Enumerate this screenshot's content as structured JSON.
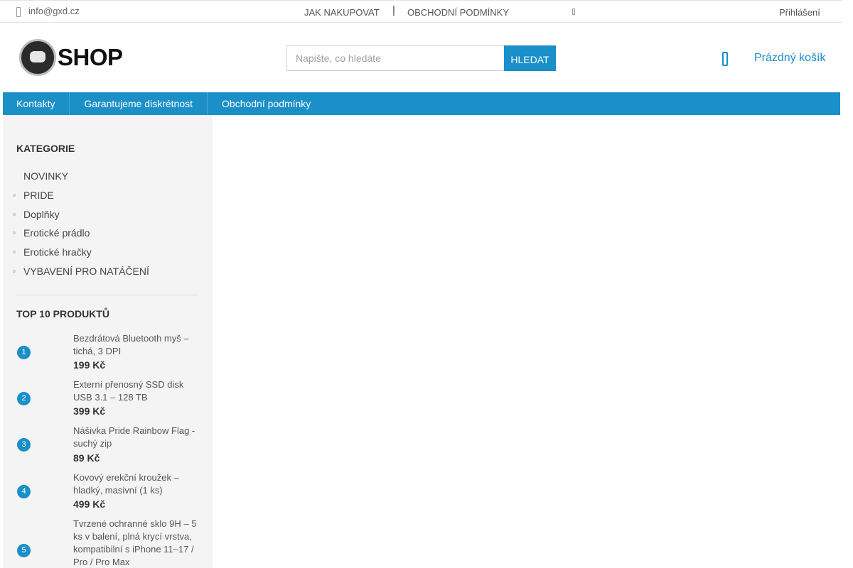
{
  "topbar": {
    "email": "info@gxd.cz",
    "links": [
      "JAK NAKUPOVAT",
      "OBCHODNÍ PODMÍNKY"
    ],
    "separator": "|",
    "login": "Přihlášení"
  },
  "header": {
    "logo_text": "SHOP",
    "search_placeholder": "Napište, co hledáte",
    "search_button": "HLEDAT",
    "cart_label": "Prázdný košík"
  },
  "nav": {
    "items": [
      "Kontakty",
      "Garantujeme diskrétnost",
      "Obchodní podmínky"
    ]
  },
  "sidebar": {
    "categories_title": "KATEGORIE",
    "categories": [
      "NOVINKY",
      "PRIDE",
      "Doplňky",
      "Erotické prádlo",
      "Erotické hračky",
      "VYBAVENÍ PRO NATÁČENÍ"
    ],
    "top_title": "TOP 10 PRODUKTŮ",
    "products": [
      {
        "rank": "1",
        "name": "Bezdrátová Bluetooth myš – tichá, 3 DPI",
        "price": "199 Kč"
      },
      {
        "rank": "2",
        "name": "Externí přenosný SSD disk USB 3.1 – 128 TB",
        "price": "399 Kč"
      },
      {
        "rank": "3",
        "name": "Nášivka Pride Rainbow Flag - suchý zip",
        "price": "89 Kč"
      },
      {
        "rank": "4",
        "name": "Kovový erekční kroužek – hladký, masivní (1 ks)",
        "price": "499 Kč"
      },
      {
        "rank": "5",
        "name": "Tvrzené ochranné sklo 9H – 5 ks v balení, plná krycí vrstva, kompatibilní s iPhone 11–17 / Pro / Pro Max",
        "price": ""
      }
    ]
  },
  "colors": {
    "accent": "#1a8fc8",
    "sidebar_bg": "#f4f4f4"
  }
}
